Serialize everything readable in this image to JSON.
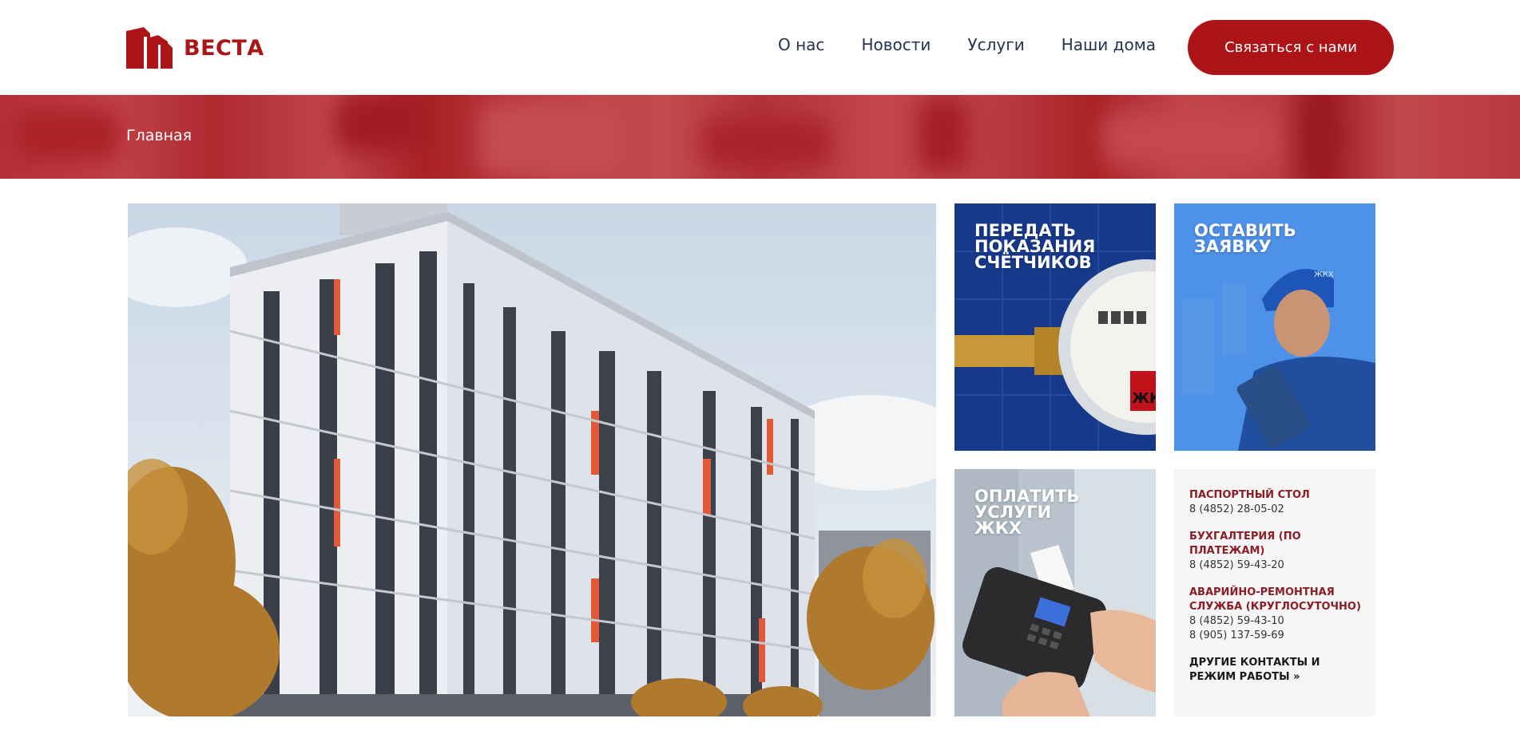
{
  "header": {
    "logo_text": "ВЕСТА",
    "nav": [
      "О нас",
      "Новости",
      "Услуги",
      "Наши дома"
    ],
    "contact_button": "Связаться с нами"
  },
  "breadcrumb": "Главная",
  "tiles": {
    "meters": {
      "title": "ПЕРЕДАТЬ\nПОКАЗАНИЯ\nСЧЁТЧИКОВ",
      "meter_label": "ЖКХ"
    },
    "request": {
      "title": "ОСТАВИТЬ\nЗАЯВКУ",
      "cap_label": "ЖКХ"
    },
    "payment": {
      "title": "ОПЛАТИТЬ\nУСЛУГИ\nЖКХ"
    }
  },
  "contacts": {
    "passport": {
      "title": "ПАСПОРТНЫЙ СТОЛ",
      "phones": [
        "8 (4852) 28-05-02"
      ]
    },
    "accounting": {
      "title": "БУХГАЛТЕРИЯ (ПО ПЛАТЕЖАМ)",
      "phones": [
        "8 (4852) 59-43-20"
      ]
    },
    "emergency": {
      "title": "АВАРИЙНО-РЕМОНТНАЯ СЛУЖБА (КРУГЛОСУТОЧНО)",
      "phones": [
        "8 (4852) 59-43-10",
        "8 (905) 137-59-69"
      ]
    },
    "more_link": "ДРУГИЕ КОНТАКТЫ И РЕЖИМ РАБОТЫ »"
  },
  "colors": {
    "brand": "#ad1418",
    "band": "#b9383d",
    "nav_text": "#243352",
    "contact_title": "#8a1d25"
  }
}
